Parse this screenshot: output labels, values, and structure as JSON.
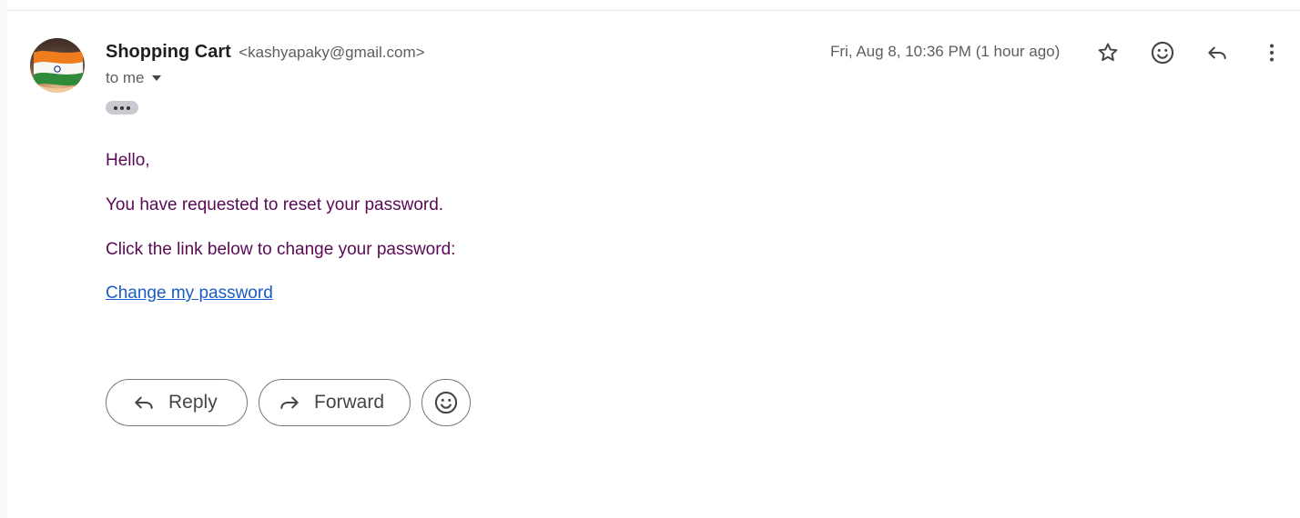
{
  "sender": {
    "name": "Shopping Cart",
    "email": "<kashyapaky@gmail.com>"
  },
  "recipient": {
    "label": "to me"
  },
  "header": {
    "timestamp": "Fri, Aug 8, 10:36 PM (1 hour ago)",
    "icons": [
      "star-icon",
      "emoji-icon",
      "reply-icon",
      "more-vert-icon"
    ]
  },
  "body": {
    "greeting": "Hello,",
    "line1": "You have requested to reset your password.",
    "line2": "Click the link below to change your password:",
    "link_text": "Change my password"
  },
  "actions": {
    "reply_label": "Reply",
    "forward_label": "Forward"
  },
  "colors": {
    "body_text": "#5a0a55",
    "link": "#1a5cc7",
    "pill_border": "#747775"
  }
}
